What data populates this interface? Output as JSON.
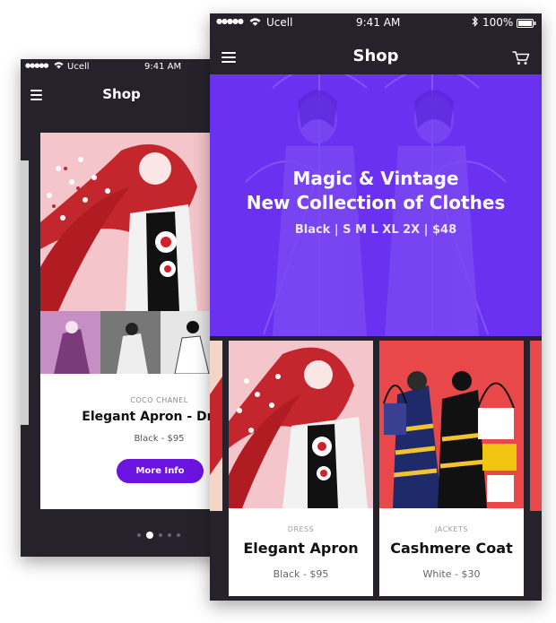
{
  "back_phone": {
    "status": {
      "carrier": "Ucell",
      "time": "9:41 AM"
    },
    "nav": {
      "title": "Shop"
    },
    "card": {
      "brand": "COCO CHANEL",
      "name": "Elegant Apron - Dress",
      "price": "Black - $95",
      "button_label": "More Info"
    },
    "pager": {
      "count": 5,
      "active": 1
    }
  },
  "front_phone": {
    "status": {
      "carrier": "Ucell",
      "time": "9:41 AM",
      "battery": "100%"
    },
    "nav": {
      "title": "Shop"
    },
    "banner": {
      "line1": "Magic & Vintage",
      "line2": "New Collection of Clothes",
      "details": "Black  |  S M L XL 2X  |  $48",
      "color": "#6a32f0"
    },
    "products": [
      {
        "category": "DRESS",
        "name": "Elegant Apron",
        "price": "Black - $95"
      },
      {
        "category": "JACKETS",
        "name": "Cashmere Coat",
        "price": "White - $30"
      }
    ]
  },
  "colors": {
    "dark": "#26222c",
    "accent": "#6b14e0",
    "banner": "#6a32f0"
  }
}
